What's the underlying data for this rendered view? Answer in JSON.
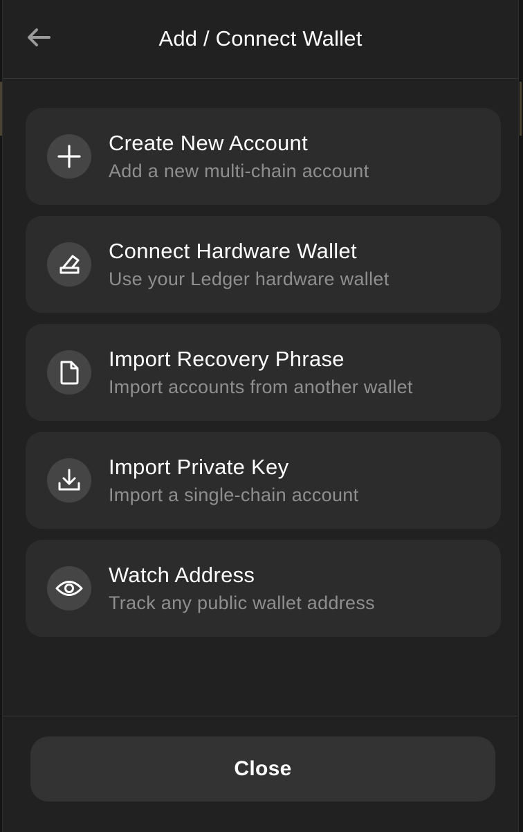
{
  "header": {
    "title": "Add / Connect Wallet",
    "back_icon": "arrow-left-icon"
  },
  "options": [
    {
      "icon": "plus-icon",
      "title": "Create New Account",
      "subtitle": "Add a new multi-chain account"
    },
    {
      "icon": "hardware-wallet-icon",
      "title": "Connect Hardware Wallet",
      "subtitle": "Use your Ledger hardware wallet"
    },
    {
      "icon": "document-icon",
      "title": "Import Recovery Phrase",
      "subtitle": "Import accounts from another wallet"
    },
    {
      "icon": "download-icon",
      "title": "Import Private Key",
      "subtitle": "Import a single-chain account"
    },
    {
      "icon": "eye-icon",
      "title": "Watch Address",
      "subtitle": "Track any public wallet address"
    }
  ],
  "footer": {
    "close_label": "Close"
  },
  "colors": {
    "background": "#212121",
    "card": "#2c2c2c",
    "icon_circle": "#454545",
    "text_primary": "#ffffff",
    "text_secondary": "#8f8f8f",
    "button": "#333333"
  }
}
